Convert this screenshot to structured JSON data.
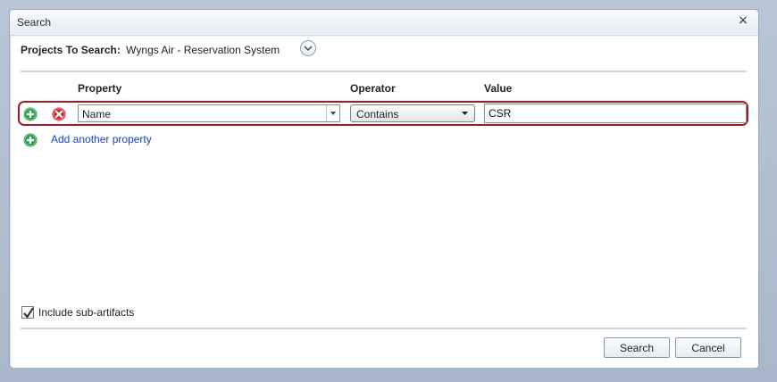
{
  "dialog": {
    "title": "Search",
    "close_glyph": "×"
  },
  "projects": {
    "label": "Projects To Search:",
    "value": "Wyngs Air - Reservation System"
  },
  "columns": {
    "property": "Property",
    "operator": "Operator",
    "value": "Value"
  },
  "criteria": {
    "property_selected": "Name",
    "operator_selected": "Contains",
    "value": "CSR"
  },
  "links": {
    "add_another_property": "Add another property"
  },
  "options": {
    "include_sub_artifacts_label": "Include sub-artifacts",
    "include_sub_artifacts_checked": true
  },
  "buttons": {
    "search": "Search",
    "cancel": "Cancel"
  },
  "colors": {
    "accent_add": "#2d9a4b",
    "accent_remove": "#c9263a",
    "highlight_border": "#a3192a",
    "link": "#1a3fc6"
  }
}
